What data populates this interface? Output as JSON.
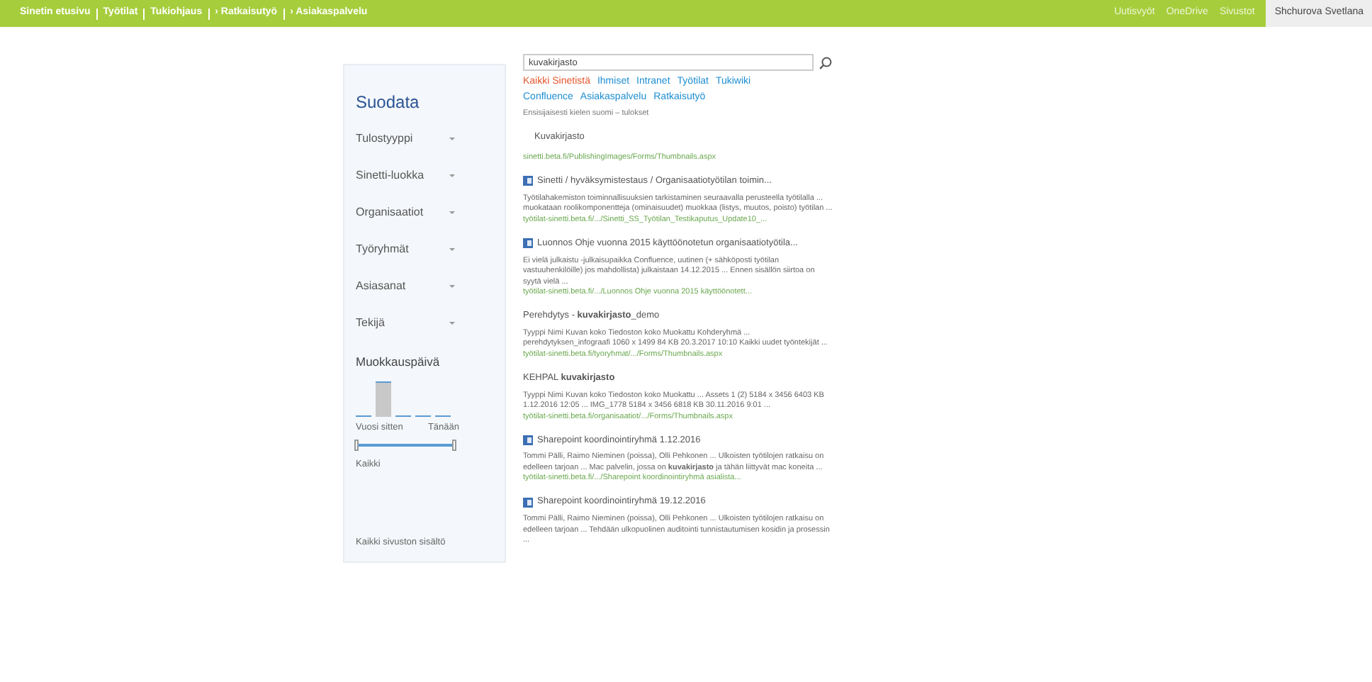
{
  "top_bar": {
    "links": [
      "Sinetin etusivu",
      "Työtilat",
      "Tukiohjaus",
      "› Ratkaisutyö",
      "› Asiakaspalvelu"
    ],
    "right_links": [
      "Uutisvyöt",
      "OneDrive",
      "Sivustot"
    ],
    "user": "Shchurova Svetlana"
  },
  "filter_panel": {
    "title": "Suodata",
    "filters": [
      "Tulostyyppi",
      "Sinetti-luokka",
      "Organisaatiot",
      "Työryhmät",
      "Asiasanat",
      "Tekijä"
    ],
    "date_filter": {
      "title": "Muokkauspäivä",
      "start_label": "Vuosi sitten",
      "end_label": "Tänään",
      "range_start": {
        "level": 0
      },
      "range_end": {
        "level": 1
      },
      "range_label": "Kaikki"
    },
    "footer": "Kaikki sivuston sisältö"
  },
  "search": {
    "value": "kuvakirjasto"
  },
  "scopes": [
    {
      "label": "Kaikki Sinetistä",
      "selected": true
    },
    {
      "label": "Ihmiset",
      "selected": false
    },
    {
      "label": "Intranet",
      "selected": false
    },
    {
      "label": "Työtilat",
      "selected": false
    },
    {
      "label": "Tukiwiki",
      "selected": false
    },
    {
      "label": "Confluence",
      "selected": false
    },
    {
      "label": "Asiakaspalvelu",
      "selected": false
    },
    {
      "label": "Ratkaisutyö",
      "selected": false
    }
  ],
  "language_note": "Ensisijaisesti kielen suomi – tulokset",
  "results": [
    {
      "kind": "plain",
      "title": "Kuvakirjasto",
      "url": "sinetti.beta.fi/PublishingImages/Forms/Thumbnails.aspx"
    },
    {
      "kind": "document",
      "title": "Sinetti / hyväksymistestaus / Organisaatiotyötilan toimin...",
      "description": "Työtilahakemiston toiminnallisuuksien tarkistaminen seuraavalla perusteella työtilalla ... muokataan roolikomponentteja (ominaisuudet) muokkaa (listys, muutos, poisto) työtilan ...",
      "url": "työtilat-sinetti.beta.fi/.../Sinetti_SS_Työtilan_Testikaputus_Update10_..."
    },
    {
      "kind": "document",
      "title": "Luonnos Ohje vuonna 2015 käyttöönotetun organisaatiotyötila...",
      "description": "Ei vielä julkaistu -julkaisupaikka Confluence, uutinen (+ sähköposti työtilan vastuuhenkilöille) jos mahdollista) julkaistaan 14.12.2015 ... Ennen sisällön siirtoa on syytä vielä ...",
      "url": "työtilat-sinetti.beta.fi/.../Luonnos Ohje vuonna 2015 käyttöönotett..."
    },
    {
      "kind": "plain",
      "title": "Perehdytys - **kuvakirjasto**_demo",
      "description": "Tyyppi   Nimi   Kuvan koko Tiedoston koko   Muokattu   Kohderyhmä ... perehdytyksen_infograafi 1060 x 1499 84 KB 20.3.2017 10:10 Kaikki uudet työntekijät ...",
      "url": "työtilat-sinetti.beta.fi/tyoryhmat/.../Forms/Thumbnails.aspx"
    },
    {
      "kind": "plain",
      "title": "KEHPAL **kuvakirjasto**",
      "description": "Tyyppi   Nimi   Kuvan koko Tiedoston koko   Muokattu ... Assets 1 (2) 5184 x 3456 6403 KB 1.12.2016 12:05 ... IMG_1778 5184 x 3456 6818 KB 30.11.2016 9:01 ...",
      "url": "työtilat-sinetti.beta.fi/organisaatiot/.../Forms/Thumbnails.aspx"
    },
    {
      "kind": "document",
      "title": "Sharepoint koordinointiryhmä 1.12.2016",
      "description": "Tommi Pälli, Raimo Nieminen (poissa), Olli Pehkonen ... Ulkoisten työtilojen ratkaisu on edelleen tarjoan ... Mac palvelin, jossa on **kuvakirjasto** ja tähän liittyvät mac koneita ...",
      "url": "työtilat-sinetti.beta.fi/.../Sharepoint koordinointiryhmä asialista..."
    },
    {
      "kind": "document",
      "title": "Sharepoint koordinointiryhmä 19.12.2016",
      "description": "Tommi Pälli, Raimo Nieminen (poissa), Olli Pehkonen ... Ulkoisten työtilojen ratkaisu on edelleen tarjoan ... Tehdään ulkopuolinen auditointi tunnistautumisen kosidin ja prosessin ..."
    }
  ]
}
